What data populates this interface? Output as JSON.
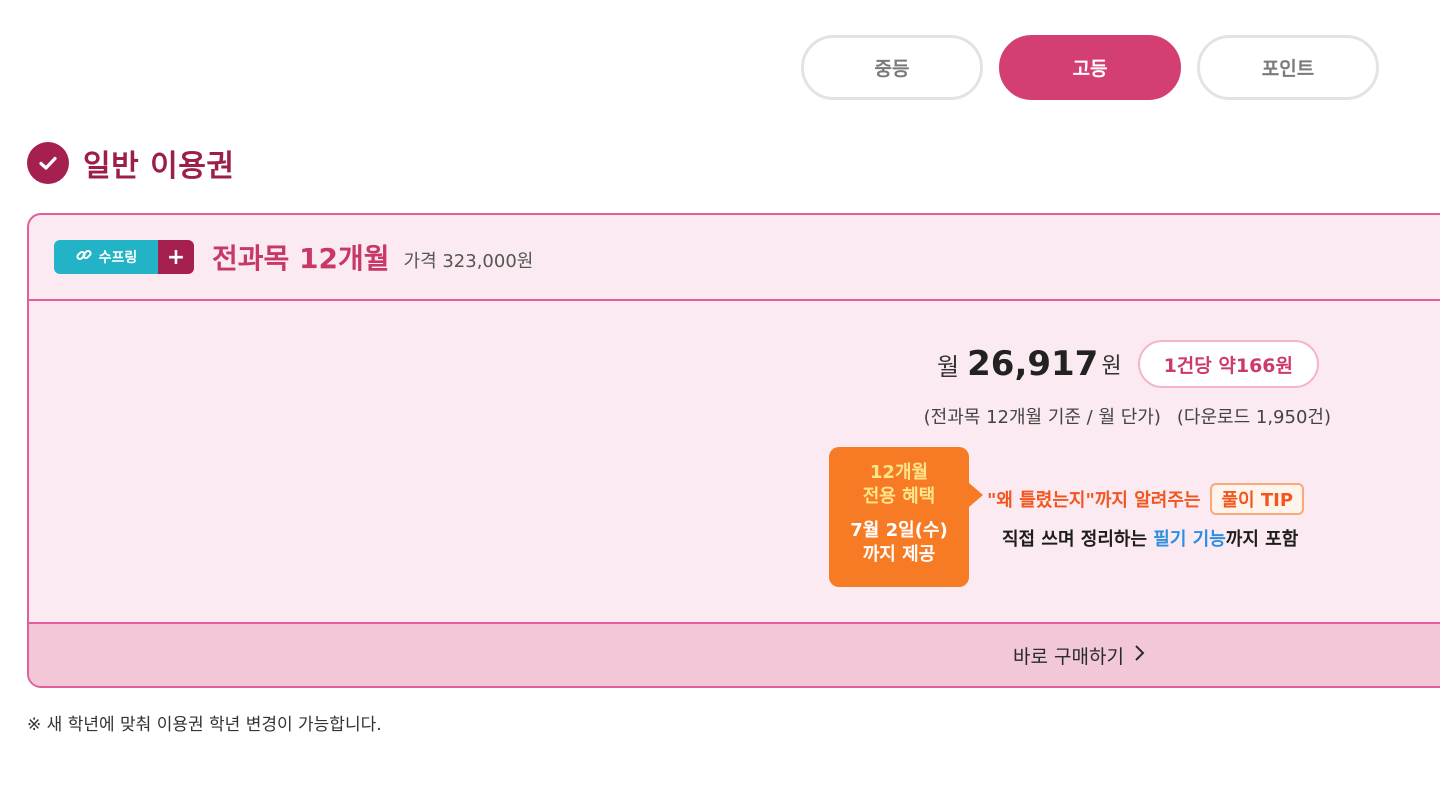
{
  "tabs": [
    {
      "label": "중등",
      "active": false
    },
    {
      "label": "고등",
      "active": true
    },
    {
      "label": "포인트",
      "active": false
    }
  ],
  "section": {
    "title": "일반 이용권",
    "icon": "check-icon"
  },
  "colors": {
    "accent": "#d43f73",
    "dark_accent": "#a52050",
    "card_bg": "#fbeaf1",
    "brand_teal": "#23b3c6",
    "benefit_orange": "#f77b25",
    "highlight_blue": "#2d8fe0"
  },
  "plan": {
    "badge_label": "수프링",
    "badge_icon": "link-icon",
    "badge_plus": "+",
    "name": "전과목 12개월",
    "price": "가격 323,000원",
    "monthly_prefix": "월",
    "monthly_value": "26,917",
    "monthly_unit": "원",
    "per_item": "1건당 약166원",
    "note_left": "(전과목 12개월 기준 / 월 단가)",
    "note_right": "(다운로드 1,950건)"
  },
  "benefit": {
    "title_line1": "12개월",
    "title_line2": "전용 혜택",
    "date_line1": "7월 2일(수)",
    "date_line2": "까지 제공",
    "line1_text": "\"왜 틀렸는지\"까지 알려주는",
    "tip": "풀이 TIP",
    "line2_prefix": "직접 쓰며 정리하는 ",
    "line2_highlight": "필기 기능",
    "line2_suffix": "까지 포함"
  },
  "buy": {
    "label": "바로 구매하기",
    "icon": "chevron-right-icon"
  },
  "footer_note": "※ 새 학년에 맞춰 이용권 학년 변경이 가능합니다."
}
